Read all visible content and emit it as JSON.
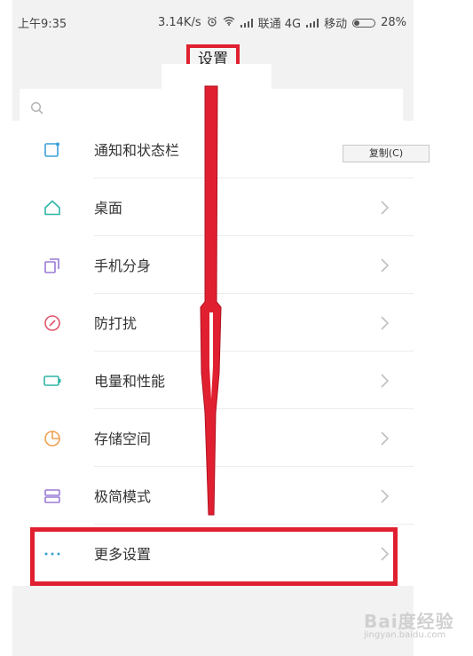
{
  "status_bar": {
    "time": "上午9:35",
    "speed": "3.14K/s",
    "carrier1": "联通 4G",
    "carrier2": "移动",
    "battery": "28%"
  },
  "header": {
    "title": "设置"
  },
  "search": {
    "placeholder": ""
  },
  "menu": {
    "items": [
      {
        "label": "通知和状态栏",
        "icon": "notification-icon",
        "color": "#3aa0d8"
      },
      {
        "label": "桌面",
        "icon": "home-icon",
        "color": "#2fb5a5"
      },
      {
        "label": "手机分身",
        "icon": "clone-icon",
        "color": "#9a7ad6"
      },
      {
        "label": "防打扰",
        "icon": "do-not-disturb-icon",
        "color": "#e0556a"
      },
      {
        "label": "电量和性能",
        "icon": "battery-icon",
        "color": "#2fb5a5"
      },
      {
        "label": "存储空间",
        "icon": "storage-icon",
        "color": "#f0a050"
      },
      {
        "label": "极简模式",
        "icon": "simple-mode-icon",
        "color": "#9a7ad6"
      },
      {
        "label": "更多设置",
        "icon": "more-icon",
        "color": "#3aa0d8"
      }
    ]
  },
  "context_menu": {
    "copy_label": "复制(C)"
  },
  "watermark": {
    "brand": "Bai度经验",
    "url": "jingyan.baidu.com"
  },
  "colors": {
    "annotation_red": "#e02030",
    "chevron": "#c0c0c0"
  }
}
